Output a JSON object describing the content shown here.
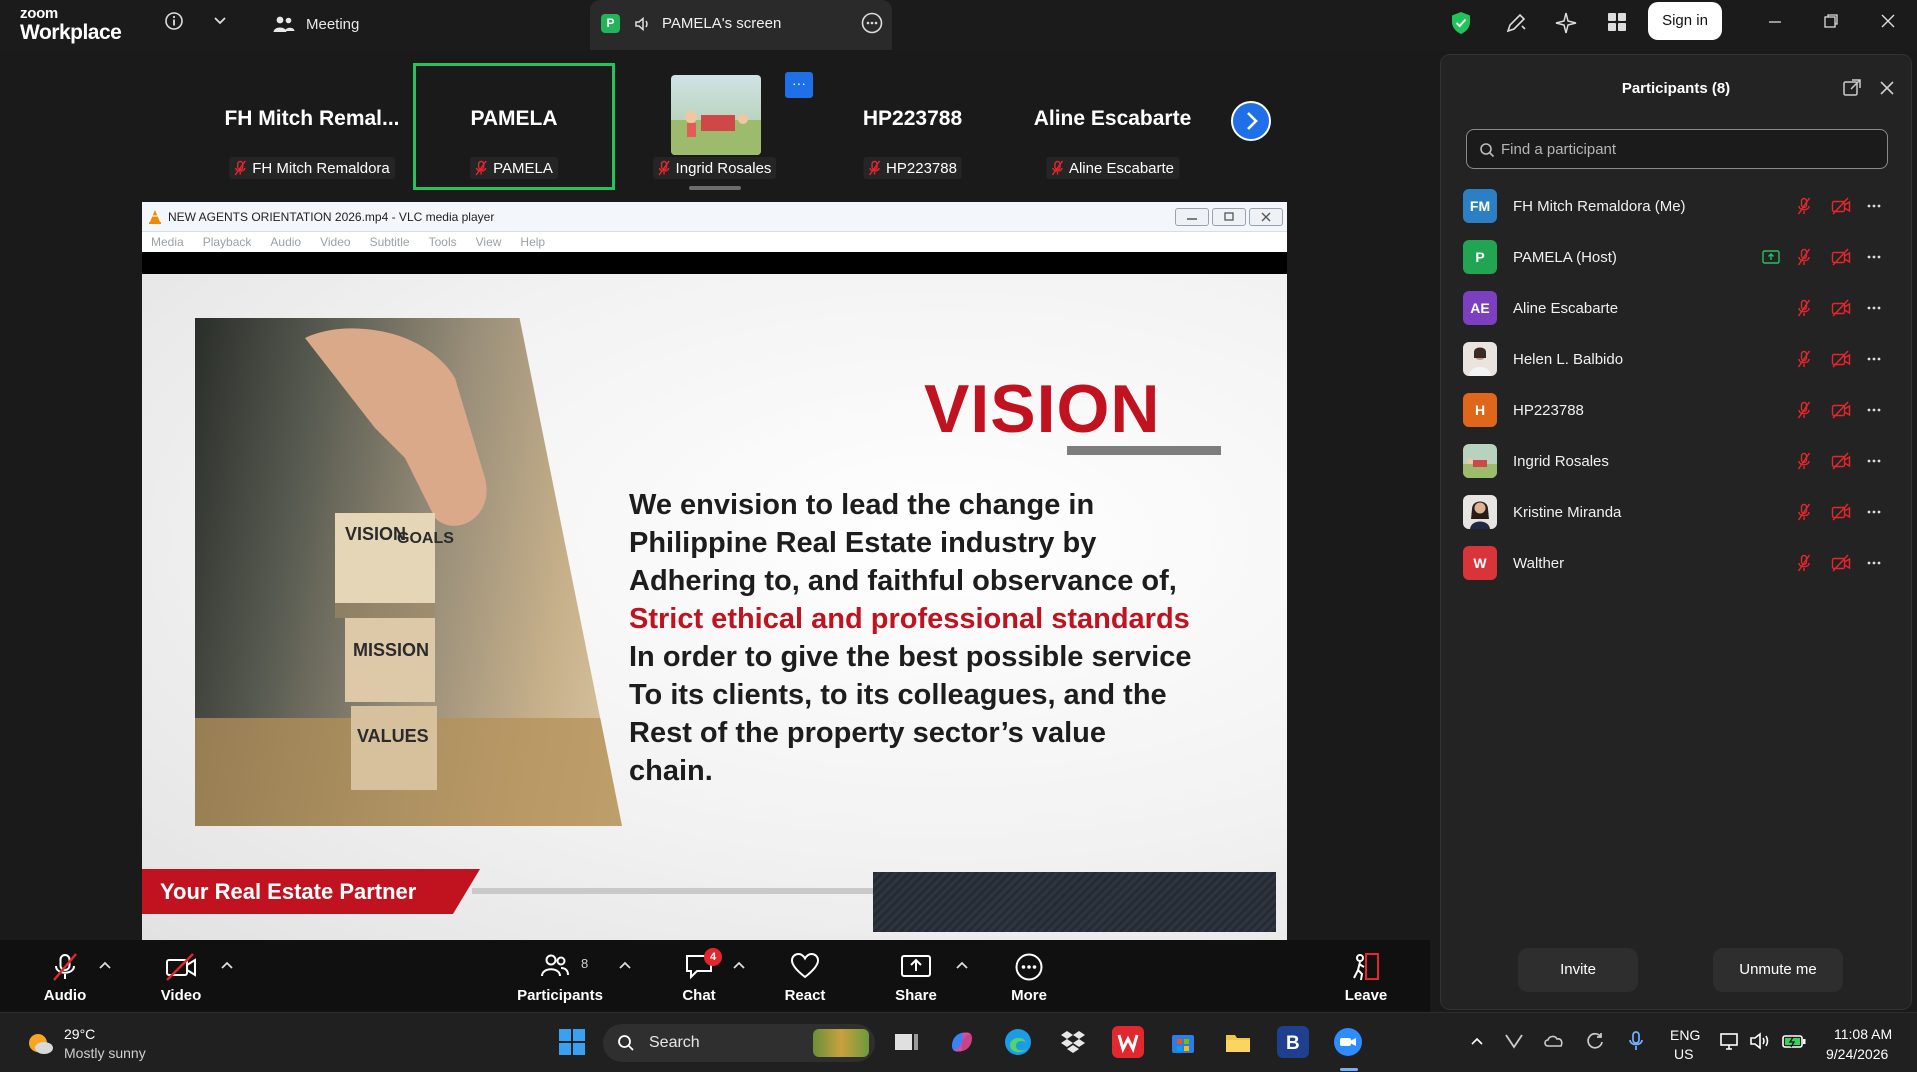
{
  "window": {
    "logo_line1": "zoom",
    "logo_line2": "Workplace",
    "meeting_label": "Meeting",
    "share_tab_badge": "P",
    "share_tab_label": "PAMELA's screen",
    "sign_in_label": "Sign in"
  },
  "gallery": {
    "overflow_label": "···",
    "tiles": [
      {
        "display": "FH  Mitch  Remal...",
        "name": "FH Mitch Remaldora"
      },
      {
        "display": "PAMELA",
        "name": "PAMELA"
      },
      {
        "display": "",
        "name": "Ingrid Rosales"
      },
      {
        "display": "HP223788",
        "name": "HP223788"
      },
      {
        "display": "Aline Escabarte",
        "name": "Aline Escabarte"
      }
    ]
  },
  "vlc": {
    "title": "NEW AGENTS ORIENTATION 2026.mp4 - VLC media player",
    "menu": [
      "Media",
      "Playback",
      "Audio",
      "Video",
      "Subtitle",
      "Tools",
      "View",
      "Help"
    ]
  },
  "slide": {
    "heading": "VISION",
    "line1": "We envision to lead the change in",
    "line2": "Philippine Real Estate industry by",
    "line3": "Adhering to, and faithful observance of,",
    "line4": "Strict ethical and professional standards",
    "line5": "In order to give the best possible service",
    "line6": "To its clients, to its colleagues, and the",
    "line7": "Rest of the property sector’s value",
    "line8": "chain.",
    "tagline": "Your Real Estate Partner",
    "blocks": [
      "VISION",
      "GOALS",
      "MISSION",
      "VALUES"
    ]
  },
  "toolbar": {
    "audio": "Audio",
    "video": "Video",
    "participants": "Participants",
    "participants_count": "8",
    "chat": "Chat",
    "chat_badge": "4",
    "react": "React",
    "share": "Share",
    "more": "More",
    "leave": "Leave"
  },
  "participants_panel": {
    "title": "Participants (8)",
    "search_placeholder": "Find a participant",
    "invite_label": "Invite",
    "unmute_label": "Unmute me",
    "list": [
      {
        "initials": "FM",
        "name": "FH Mitch Remaldora (Me)",
        "color": "#2d7fc4"
      },
      {
        "initials": "P",
        "name": "PAMELA (Host)",
        "color": "#22a552"
      },
      {
        "initials": "AE",
        "name": "Aline Escabarte",
        "color": "#7b3fbf"
      },
      {
        "initials": "",
        "name": "Helen L. Balbido",
        "color": "#e9e4df"
      },
      {
        "initials": "H",
        "name": "HP223788",
        "color": "#e0661b"
      },
      {
        "initials": "",
        "name": "Ingrid Rosales",
        "color": "#b9d2bd"
      },
      {
        "initials": "",
        "name": "Kristine Miranda",
        "color": "#e8e4e2"
      },
      {
        "initials": "W",
        "name": "Walther",
        "color": "#d9343a"
      }
    ]
  },
  "taskbar": {
    "temp": "29°C",
    "weather": "Mostly sunny",
    "search_label": "Search",
    "lang1": "ENG",
    "lang2": "US",
    "time": "11:08 AM",
    "date": "9/24/2026"
  },
  "colors": {
    "accent_blue": "#1f6fe8",
    "active_speaker_green": "#26c25e",
    "mute_red": "#e5262c",
    "slide_red": "#c1121f"
  }
}
